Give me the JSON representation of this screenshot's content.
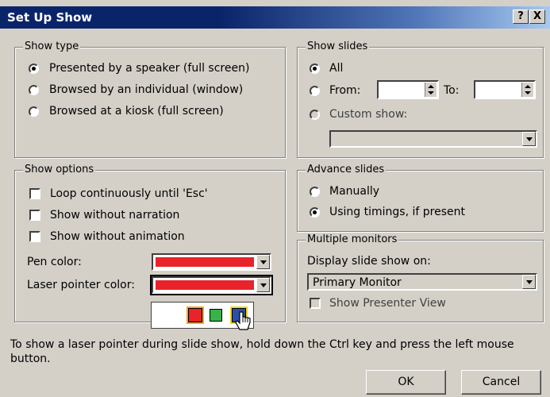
{
  "window": {
    "title": "Set Up Show",
    "help_button": "?",
    "close_button": "X"
  },
  "show_type": {
    "legend": "Show type",
    "options": [
      {
        "label": "Presented by a speaker (full screen)",
        "selected": true
      },
      {
        "label": "Browsed by an individual (window)",
        "selected": false
      },
      {
        "label": "Browsed at a kiosk (full screen)",
        "selected": false
      }
    ]
  },
  "show_slides": {
    "legend": "Show slides",
    "all_label": "All",
    "from_label": "From:",
    "to_label": "To:",
    "from_value": "",
    "to_value": "",
    "custom_label": "Custom show:",
    "custom_value": "",
    "selected": "All"
  },
  "show_options": {
    "legend": "Show options",
    "checkboxes": [
      {
        "label": "Loop continuously until 'Esc'",
        "checked": false
      },
      {
        "label": "Show without narration",
        "checked": false
      },
      {
        "label": "Show without animation",
        "checked": false
      }
    ],
    "pen_color_label": "Pen color:",
    "pen_color": "#e8232b",
    "laser_color_label": "Laser pointer color:",
    "laser_color": "#e8232b",
    "laser_palette": [
      {
        "color": "#e8232b",
        "name": "red"
      },
      {
        "color": "#37b34a",
        "name": "green"
      },
      {
        "color": "#2b4ea8",
        "name": "blue"
      }
    ]
  },
  "advance_slides": {
    "legend": "Advance slides",
    "options": [
      {
        "label": "Manually",
        "selected": false
      },
      {
        "label": "Using timings, if present",
        "selected": true
      }
    ]
  },
  "multiple_monitors": {
    "legend": "Multiple monitors",
    "display_label": "Display slide show on:",
    "display_value": "Primary Monitor",
    "presenter_view_label": "Show Presenter View",
    "presenter_view_checked": false
  },
  "footer_text": "To show a laser pointer during slide show, hold down the Ctrl key and press the left mouse button.",
  "buttons": {
    "ok": "OK",
    "cancel": "Cancel"
  },
  "colors": {
    "face": "#d4d0c8",
    "title_start": "#0a246a",
    "title_end": "#a6caf0",
    "highlight_border": "#f5a623"
  }
}
